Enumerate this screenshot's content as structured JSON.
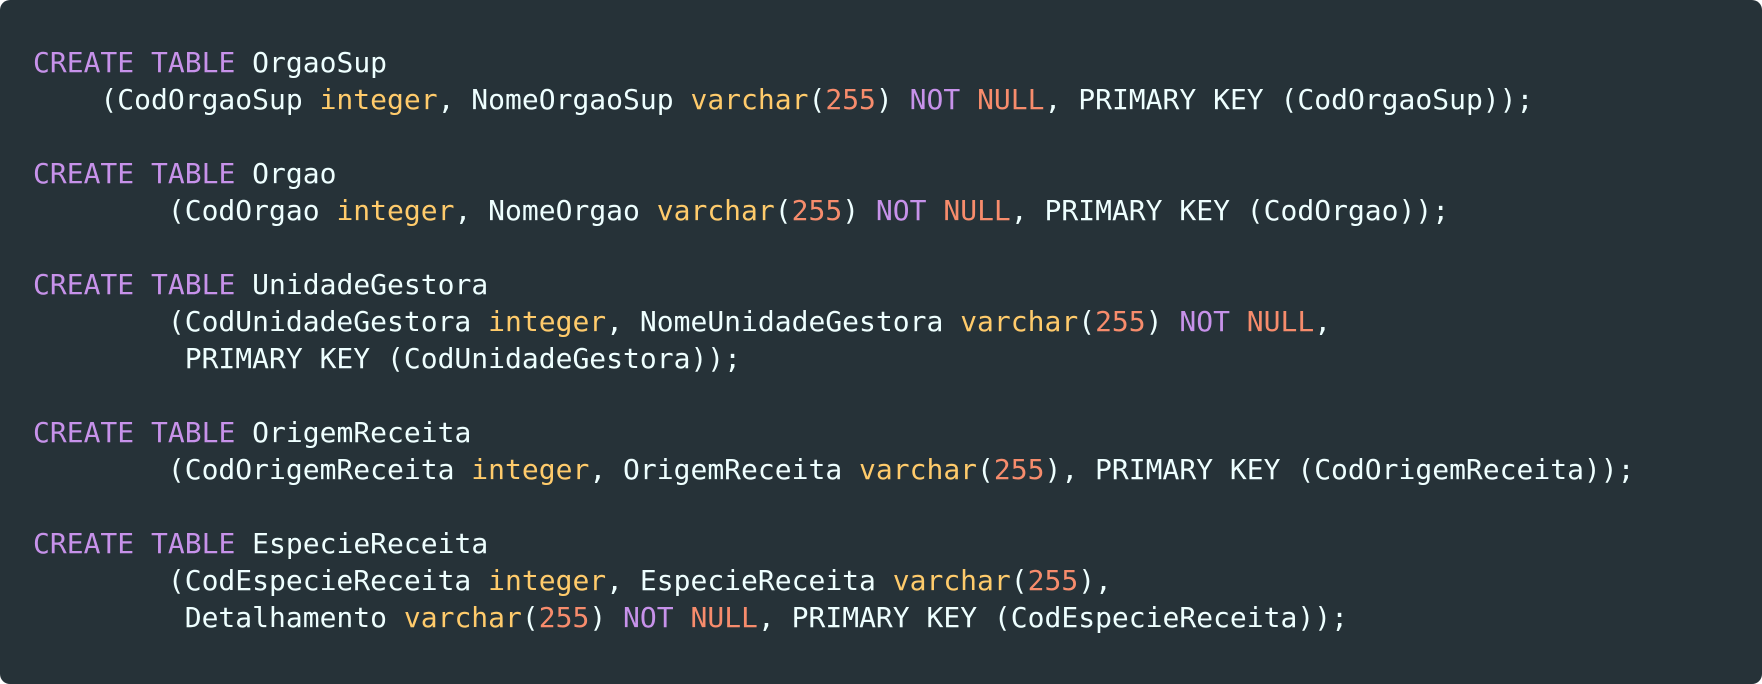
{
  "theme": {
    "background": "#263238",
    "text": "#eeffff",
    "keyword": "#c792ea",
    "type": "#ffcb6b",
    "number": "#f78c6c"
  },
  "code": {
    "language": "sql",
    "lines": [
      [
        [
          "kw",
          "CREATE"
        ],
        [
          "pl",
          " "
        ],
        [
          "kw",
          "TABLE"
        ],
        [
          "pl",
          " OrgaoSup"
        ]
      ],
      [
        [
          "pl",
          "    (CodOrgaoSup "
        ],
        [
          "ty",
          "integer"
        ],
        [
          "pl",
          ", NomeOrgaoSup "
        ],
        [
          "ty",
          "varchar"
        ],
        [
          "pl",
          "("
        ],
        [
          "num",
          "255"
        ],
        [
          "pl",
          ") "
        ],
        [
          "kw",
          "NOT"
        ],
        [
          "pl",
          " "
        ],
        [
          "nul",
          "NULL"
        ],
        [
          "pl",
          ", PRIMARY KEY (CodOrgaoSup));"
        ]
      ],
      [],
      [
        [
          "kw",
          "CREATE"
        ],
        [
          "pl",
          " "
        ],
        [
          "kw",
          "TABLE"
        ],
        [
          "pl",
          " Orgao"
        ]
      ],
      [
        [
          "pl",
          "        (CodOrgao "
        ],
        [
          "ty",
          "integer"
        ],
        [
          "pl",
          ", NomeOrgao "
        ],
        [
          "ty",
          "varchar"
        ],
        [
          "pl",
          "("
        ],
        [
          "num",
          "255"
        ],
        [
          "pl",
          ") "
        ],
        [
          "kw",
          "NOT"
        ],
        [
          "pl",
          " "
        ],
        [
          "nul",
          "NULL"
        ],
        [
          "pl",
          ", PRIMARY KEY (CodOrgao));"
        ]
      ],
      [],
      [
        [
          "kw",
          "CREATE"
        ],
        [
          "pl",
          " "
        ],
        [
          "kw",
          "TABLE"
        ],
        [
          "pl",
          " UnidadeGestora"
        ]
      ],
      [
        [
          "pl",
          "        (CodUnidadeGestora "
        ],
        [
          "ty",
          "integer"
        ],
        [
          "pl",
          ", NomeUnidadeGestora "
        ],
        [
          "ty",
          "varchar"
        ],
        [
          "pl",
          "("
        ],
        [
          "num",
          "255"
        ],
        [
          "pl",
          ") "
        ],
        [
          "kw",
          "NOT"
        ],
        [
          "pl",
          " "
        ],
        [
          "nul",
          "NULL"
        ],
        [
          "pl",
          ","
        ]
      ],
      [
        [
          "pl",
          "         PRIMARY KEY (CodUnidadeGestora));"
        ]
      ],
      [],
      [
        [
          "kw",
          "CREATE"
        ],
        [
          "pl",
          " "
        ],
        [
          "kw",
          "TABLE"
        ],
        [
          "pl",
          " OrigemReceita"
        ]
      ],
      [
        [
          "pl",
          "        (CodOrigemReceita "
        ],
        [
          "ty",
          "integer"
        ],
        [
          "pl",
          ", OrigemReceita "
        ],
        [
          "ty",
          "varchar"
        ],
        [
          "pl",
          "("
        ],
        [
          "num",
          "255"
        ],
        [
          "pl",
          "), PRIMARY KEY (CodOrigemReceita));"
        ]
      ],
      [],
      [
        [
          "kw",
          "CREATE"
        ],
        [
          "pl",
          " "
        ],
        [
          "kw",
          "TABLE"
        ],
        [
          "pl",
          " EspecieReceita"
        ]
      ],
      [
        [
          "pl",
          "        (CodEspecieReceita "
        ],
        [
          "ty",
          "integer"
        ],
        [
          "pl",
          ", EspecieReceita "
        ],
        [
          "ty",
          "varchar"
        ],
        [
          "pl",
          "("
        ],
        [
          "num",
          "255"
        ],
        [
          "pl",
          "),"
        ]
      ],
      [
        [
          "pl",
          "         Detalhamento "
        ],
        [
          "ty",
          "varchar"
        ],
        [
          "pl",
          "("
        ],
        [
          "num",
          "255"
        ],
        [
          "pl",
          ") "
        ],
        [
          "kw",
          "NOT"
        ],
        [
          "pl",
          " "
        ],
        [
          "nul",
          "NULL"
        ],
        [
          "pl",
          ", PRIMARY KEY (CodEspecieReceita));"
        ]
      ]
    ]
  }
}
